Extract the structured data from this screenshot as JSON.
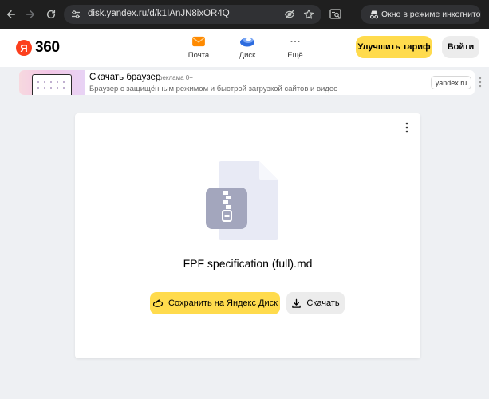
{
  "browser": {
    "url": "disk.yandex.ru/d/k1IAnJN8ixOR4Q",
    "incognito_label": "Окно в режиме инкогнито",
    "icons": [
      "back-arrow-icon",
      "forward-arrow-icon",
      "reload-icon",
      "site-info-icon",
      "eye-off-icon",
      "star-icon",
      "tab-search-icon",
      "incognito-icon"
    ]
  },
  "header": {
    "logo_letter": "Я",
    "logo_text": "360",
    "services": [
      {
        "label": "Почта",
        "icon": "mail-icon"
      },
      {
        "label": "Диск",
        "icon": "disk-icon"
      },
      {
        "label": "Ещё",
        "icon": "more-dots-icon"
      }
    ],
    "upgrade_label": "Улучшить тариф",
    "login_label": "Войти",
    "colors": {
      "logo_red": "#fc3f1d",
      "accent_yellow": "#ffdb4d",
      "disk_blue": "#2d6cdf",
      "mail_orange": "#ff8a00"
    }
  },
  "ad": {
    "title": "Скачать браузер",
    "tag": "реклама  0+",
    "description": "Браузер с защищённым режимом и быстрой загрузкой сайтов и видео",
    "domain": "yandex.ru"
  },
  "file": {
    "name": "FPF specification (full).md",
    "icon": "zip-file-icon",
    "save_label": "Сохранить на Яндекс Диск",
    "download_label": "Скачать"
  }
}
